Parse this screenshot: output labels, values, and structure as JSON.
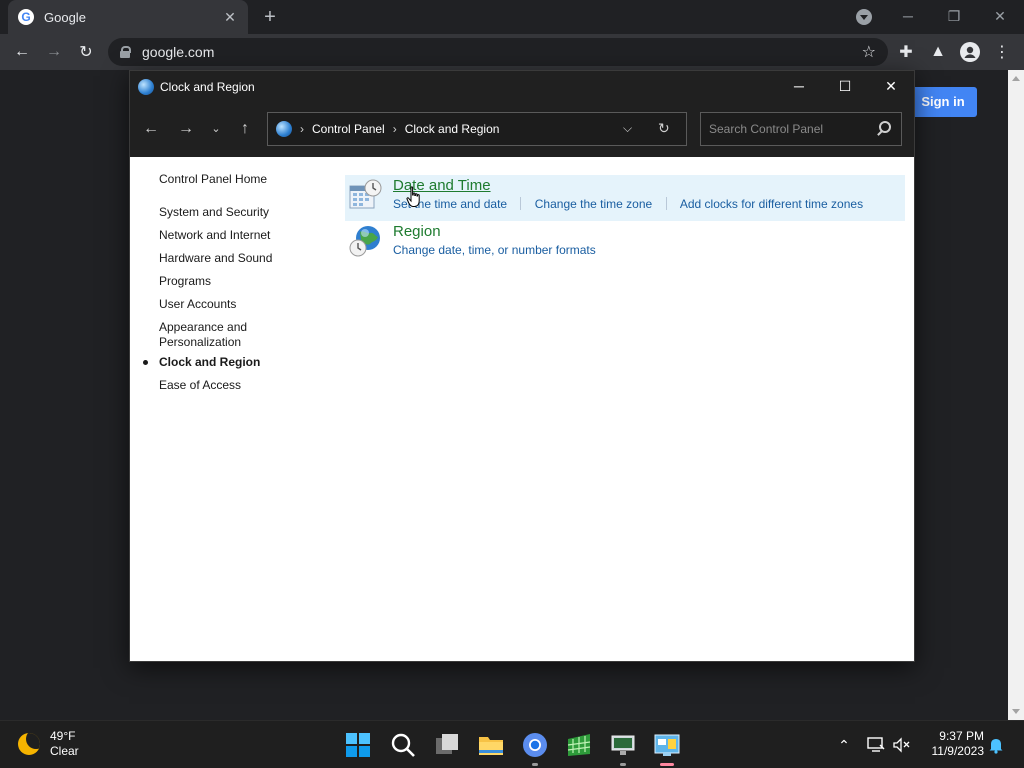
{
  "browser": {
    "tab_title": "Google",
    "favicon_letter": "G",
    "url": "google.com",
    "sign_in_label": "Sign in"
  },
  "window": {
    "title": "Clock and Region",
    "breadcrumb": [
      "Control Panel",
      "Clock and Region"
    ],
    "search_placeholder": "Search Control Panel"
  },
  "sidebar": {
    "home": "Control Panel Home",
    "items": [
      {
        "label": "System and Security"
      },
      {
        "label": "Network and Internet"
      },
      {
        "label": "Hardware and Sound"
      },
      {
        "label": "Programs"
      },
      {
        "label": "User Accounts"
      },
      {
        "label": "Appearance and Personalization"
      },
      {
        "label": "Clock and Region",
        "active": true
      },
      {
        "label": "Ease of Access"
      }
    ]
  },
  "categories": [
    {
      "heading": "Date and Time",
      "links": [
        "Set the time and date",
        "Change the time zone",
        "Add clocks for different time zones"
      ],
      "icon": "calendar-clock-icon"
    },
    {
      "heading": "Region",
      "links": [
        "Change date, time, or number formats"
      ],
      "icon": "globe-clock-icon"
    }
  ],
  "taskbar": {
    "weather_temp": "49°F",
    "weather_desc": "Clear",
    "time": "9:37 PM",
    "date": "11/9/2023"
  },
  "colors": {
    "heading_green": "#1e7b2f",
    "link_blue": "#1a5ea1",
    "hover_bg": "#e5f3fb",
    "google_blue": "#4285f4"
  }
}
